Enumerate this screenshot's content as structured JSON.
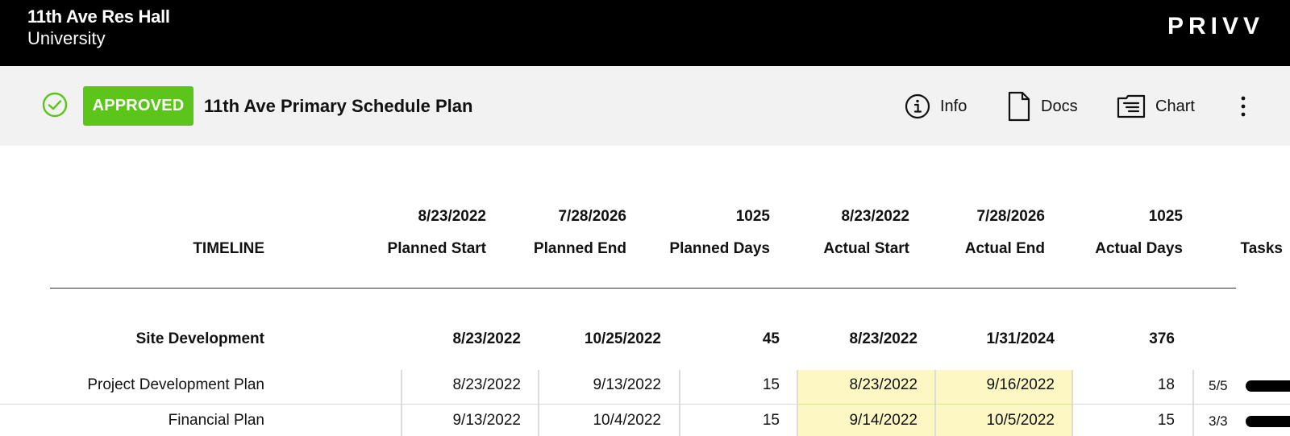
{
  "header": {
    "project_name": "11th Ave Res Hall",
    "org_name": "University",
    "brand": "PRIVV"
  },
  "toolbar": {
    "status": "APPROVED",
    "plan_title": "11th Ave Primary Schedule Plan",
    "info_label": "Info",
    "docs_label": "Docs",
    "chart_label": "Chart"
  },
  "table": {
    "timeline_label": "TIMELINE",
    "summary": {
      "planned_start": "8/23/2022",
      "planned_end": "7/28/2026",
      "planned_days": "1025",
      "actual_start": "8/23/2022",
      "actual_end": "7/28/2026",
      "actual_days": "1025"
    },
    "columns": {
      "planned_start": "Planned Start",
      "planned_end": "Planned End",
      "planned_days": "Planned Days",
      "actual_start": "Actual Start",
      "actual_end": "Actual End",
      "actual_days": "Actual Days",
      "tasks": "Tasks"
    },
    "group": {
      "name": "Site Development",
      "planned_start": "8/23/2022",
      "planned_end": "10/25/2022",
      "planned_days": "45",
      "actual_start": "8/23/2022",
      "actual_end": "1/31/2024",
      "actual_days": "376"
    },
    "rows": [
      {
        "name": "Project Development Plan",
        "planned_start": "8/23/2022",
        "planned_end": "9/13/2022",
        "planned_days": "15",
        "actual_start": "8/23/2022",
        "actual_end": "9/16/2022",
        "actual_days": "18",
        "tasks": "5/5",
        "tasks_progress": 1.0
      },
      {
        "name": "Financial Plan",
        "planned_start": "9/13/2022",
        "planned_end": "10/4/2022",
        "planned_days": "15",
        "actual_start": "9/14/2022",
        "actual_end": "10/5/2022",
        "actual_days": "15",
        "tasks": "3/3",
        "tasks_progress": 1.0
      }
    ]
  },
  "colors": {
    "approved": "#5cc51a",
    "actual_highlight": "#fdf8c3",
    "topbar": "#000000"
  }
}
